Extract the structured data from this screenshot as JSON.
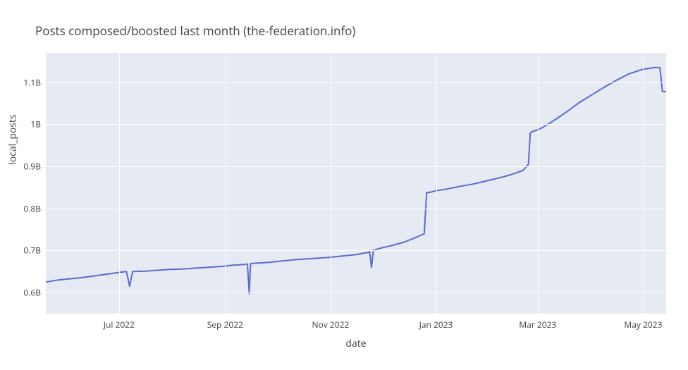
{
  "chart_data": {
    "type": "line",
    "title": "Posts composed/boosted last month (the-federation.info)",
    "xlabel": "date",
    "ylabel": "local_posts",
    "ylim": [
      0.55,
      1.17
    ],
    "y_ticks": [
      0.6,
      0.7,
      0.8,
      0.9,
      1.0,
      1.1
    ],
    "y_tick_labels": [
      "0.6B",
      "0.7B",
      "0.8B",
      "0.9B",
      "1B",
      "1.1B"
    ],
    "x_tick_labels": [
      "Jul 2022",
      "Sep 2022",
      "Nov 2022",
      "Jan 2023",
      "Mar 2023",
      "May 2023"
    ],
    "x_tick_positions": [
      0.118,
      0.289,
      0.459,
      0.629,
      0.793,
      0.963
    ],
    "series": [
      {
        "name": "local_posts",
        "x_frac": [
          0.0,
          0.02,
          0.04,
          0.06,
          0.08,
          0.1,
          0.118,
          0.13,
          0.135,
          0.14,
          0.16,
          0.18,
          0.2,
          0.22,
          0.24,
          0.26,
          0.28,
          0.289,
          0.3,
          0.32,
          0.325,
          0.328,
          0.33,
          0.34,
          0.36,
          0.38,
          0.4,
          0.42,
          0.44,
          0.459,
          0.478,
          0.498,
          0.518,
          0.522,
          0.525,
          0.528,
          0.538,
          0.558,
          0.578,
          0.598,
          0.61,
          0.614,
          0.618,
          0.629,
          0.649,
          0.669,
          0.689,
          0.709,
          0.729,
          0.749,
          0.769,
          0.778,
          0.781,
          0.785,
          0.793,
          0.8,
          0.82,
          0.84,
          0.86,
          0.88,
          0.9,
          0.92,
          0.94,
          0.96,
          0.98,
          0.99,
          0.994,
          1.0
        ],
        "values_billions": [
          0.625,
          0.63,
          0.633,
          0.636,
          0.64,
          0.644,
          0.648,
          0.65,
          0.615,
          0.65,
          0.651,
          0.653,
          0.655,
          0.656,
          0.658,
          0.66,
          0.662,
          0.663,
          0.665,
          0.667,
          0.668,
          0.598,
          0.669,
          0.67,
          0.672,
          0.675,
          0.678,
          0.68,
          0.682,
          0.684,
          0.687,
          0.69,
          0.695,
          0.697,
          0.66,
          0.7,
          0.705,
          0.712,
          0.72,
          0.732,
          0.74,
          0.838,
          0.838,
          0.842,
          0.847,
          0.853,
          0.858,
          0.865,
          0.872,
          0.88,
          0.89,
          0.905,
          0.98,
          0.983,
          0.987,
          0.992,
          1.01,
          1.03,
          1.052,
          1.07,
          1.088,
          1.105,
          1.12,
          1.13,
          1.135,
          1.135,
          1.078,
          1.078
        ]
      }
    ]
  }
}
